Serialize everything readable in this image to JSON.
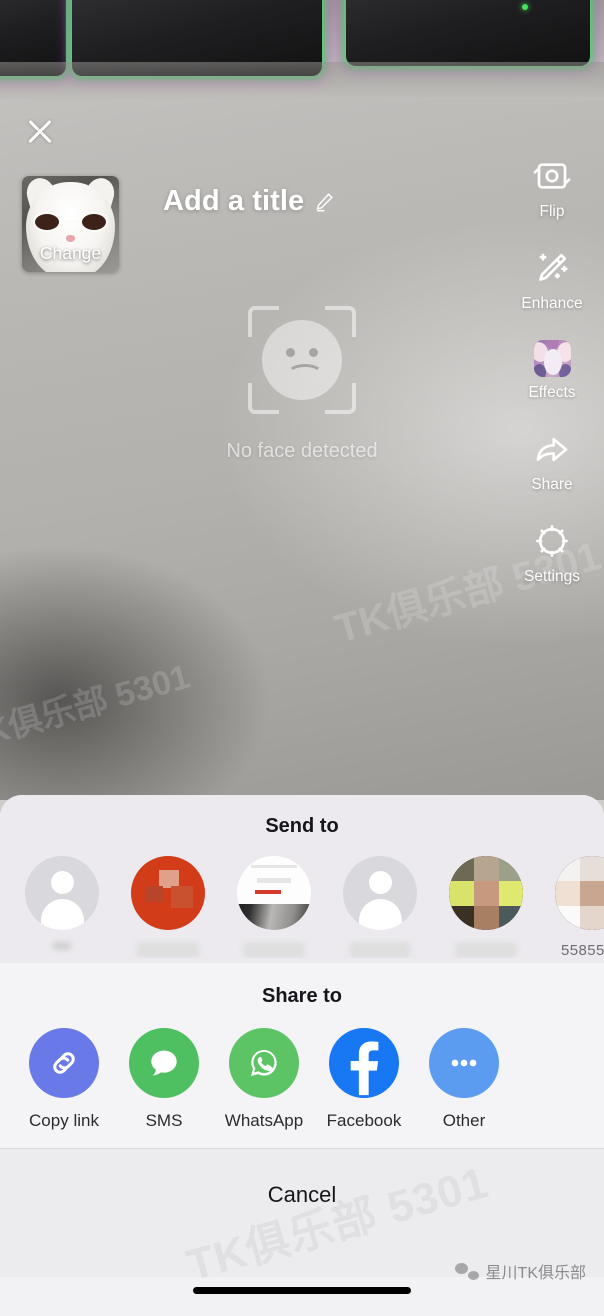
{
  "screen": {
    "close_icon": "close-x-icon",
    "title_placeholder": "Add a title",
    "edit_icon": "pencil-icon",
    "thumbnail": {
      "label": "Change",
      "alt": "cat-wearing-sunglasses-photo"
    }
  },
  "toolbar": [
    {
      "label": "Flip",
      "icon": "camera-flip-icon"
    },
    {
      "label": "Enhance",
      "icon": "magic-wand-icon"
    },
    {
      "label": "Effects",
      "icon": "effects-thumbnail-icon"
    },
    {
      "label": "Share",
      "icon": "share-arrow-icon"
    },
    {
      "label": "Settings",
      "icon": "gear-icon"
    }
  ],
  "viewfinder": {
    "status_text": "No face detected",
    "face_icon": "sad-face-icon"
  },
  "send_to": {
    "title": "Send to",
    "contacts": [
      {
        "name": "",
        "avatar": "default-person-avatar",
        "name_state": "blurred"
      },
      {
        "name": "",
        "avatar": "red-photo-avatar",
        "name_state": "blurred"
      },
      {
        "name": "",
        "avatar": "screenshot-avatar",
        "name_state": "blurred"
      },
      {
        "name": "",
        "avatar": "default-person-avatar",
        "name_state": "blurred"
      },
      {
        "name": "",
        "avatar": "pixelated-photo-avatar",
        "name_state": "blurred"
      },
      {
        "name": "55855",
        "avatar": "pixelated-photo-avatar",
        "name_state": "partial"
      }
    ]
  },
  "share_to": {
    "title": "Share to",
    "targets": [
      {
        "label": "Copy link",
        "icon": "link-chain-icon",
        "color": "#6a79e8"
      },
      {
        "label": "SMS",
        "icon": "message-bubble-icon",
        "color": "#4fc061"
      },
      {
        "label": "WhatsApp",
        "icon": "whatsapp-icon",
        "color": "#5dc466"
      },
      {
        "label": "Facebook",
        "icon": "facebook-icon",
        "color": "#1877f2"
      },
      {
        "label": "Other",
        "icon": "ellipsis-icon",
        "color": "#5b9bf0"
      }
    ]
  },
  "footer": {
    "cancel_label": "Cancel"
  },
  "watermark": {
    "text": "星川TK俱乐部",
    "icon": "wechat-icon",
    "ghost_text": "TK俱乐部 5301"
  }
}
